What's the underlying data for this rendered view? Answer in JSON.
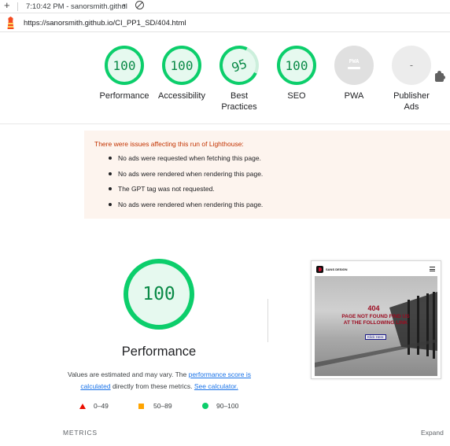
{
  "browser": {
    "tab_title": "7:10:42 PM - sanorsmith.githul",
    "url": "https://sanorsmith.github.io/CI_PP1_SD/404.html",
    "new_tab_glyph": "+",
    "caret_glyph": "▾"
  },
  "gauges": [
    {
      "score": "100",
      "label": "Performance"
    },
    {
      "score": "100",
      "label": "Accessibility"
    },
    {
      "score": "95",
      "label": "Best Practices"
    },
    {
      "score": "100",
      "label": "SEO"
    },
    {
      "score": "",
      "label": "PWA",
      "icon": "pwa-icon",
      "mark": "PWA"
    },
    {
      "score": "-",
      "label": "Publisher Ads",
      "icon": "puzzle-icon"
    }
  ],
  "warnings": {
    "heading": "There were issues affecting this run of Lighthouse:",
    "items": [
      "No ads were requested when fetching this page.",
      "No ads were rendered when rendering this page.",
      "The GPT tag was not requested.",
      "No ads were rendered when rendering this page."
    ]
  },
  "performance": {
    "score": "100",
    "title": "Performance",
    "note_prefix": "Values are estimated and may vary. The ",
    "note_link1": "performance score is calculated",
    "note_mid": " directly from these metrics. ",
    "note_link2": "See calculator."
  },
  "legend": [
    {
      "range": "0–49",
      "color": "#eb0f00",
      "shape": "triangle"
    },
    {
      "range": "50–89",
      "color": "#ffa400",
      "shape": "square"
    },
    {
      "range": "90–100",
      "color": "#0cce6b",
      "shape": "circle"
    }
  ],
  "metrics_label": "METRICS",
  "expand_label": "Expand",
  "thumbnail": {
    "brand": "SANS DESIGN",
    "heading": "404",
    "message": "PAGE NOT FOUND FIND US AT THE FOLLOWING LINK",
    "button": "Klick Here"
  },
  "colors": {
    "pass": "#0cce6b",
    "pass_text": "#0a8a47",
    "warning_text": "#c33300",
    "warning_bg": "#fdf4ee",
    "link": "#1a73e8"
  }
}
